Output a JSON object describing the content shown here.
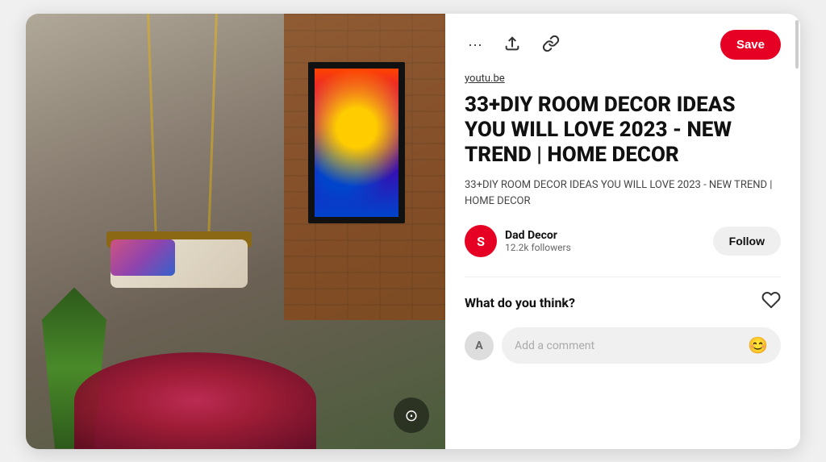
{
  "card": {
    "save_button_label": "Save",
    "source_link": "youtu.be",
    "pin_title": "33+DIY ROOM DECOR IDEAS YOU WILL LOVE 2023 - NEW TREND | HOME DECOR",
    "pin_description": "33+DIY ROOM DECOR IDEAS YOU WILL LOVE 2023 - NEW TREND | HOME DECOR",
    "creator": {
      "initial": "S",
      "name": "Dad Decor",
      "followers": "12.2k followers"
    },
    "follow_button_label": "Follow",
    "what_think_label": "What do you think?",
    "comment_placeholder": "Add a comment",
    "comment_avatar_initial": "A",
    "icons": {
      "more": "···",
      "upload": "⬆",
      "link": "🔗",
      "heart": "♡",
      "emoji": "😊",
      "scan": "⊙"
    }
  }
}
